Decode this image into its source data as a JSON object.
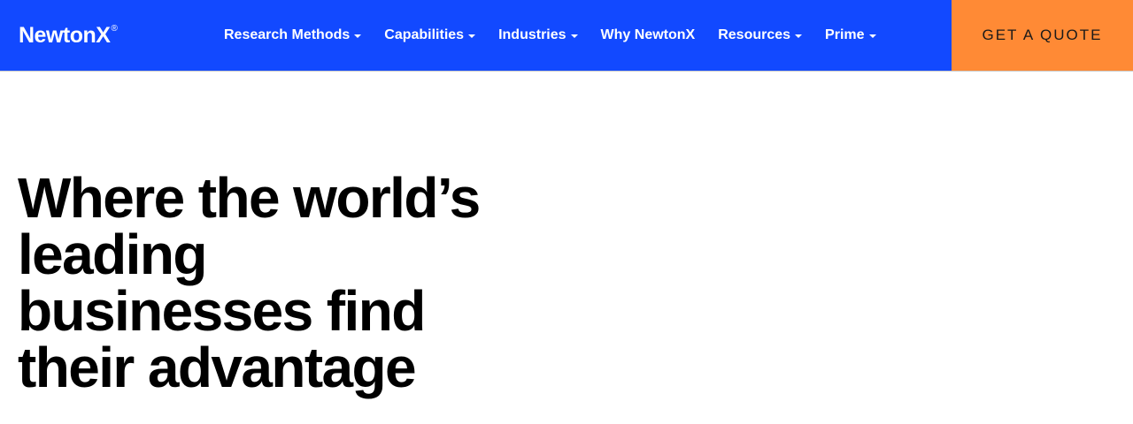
{
  "brand": {
    "name": "NewtonX",
    "registered_mark": "®",
    "color": "#1249ff"
  },
  "nav": {
    "items": [
      {
        "label": "Research Methods",
        "has_dropdown": true
      },
      {
        "label": "Capabilities",
        "has_dropdown": true
      },
      {
        "label": "Industries",
        "has_dropdown": true
      },
      {
        "label": "Why NewtonX",
        "has_dropdown": false
      },
      {
        "label": "Resources",
        "has_dropdown": true
      },
      {
        "label": "Prime",
        "has_dropdown": true
      }
    ],
    "cta": {
      "label": "GET A QUOTE",
      "color": "#ff8a35"
    }
  },
  "hero": {
    "title_lines": [
      "Where the world’s",
      "leading",
      "businesses find",
      "their advantage"
    ]
  }
}
